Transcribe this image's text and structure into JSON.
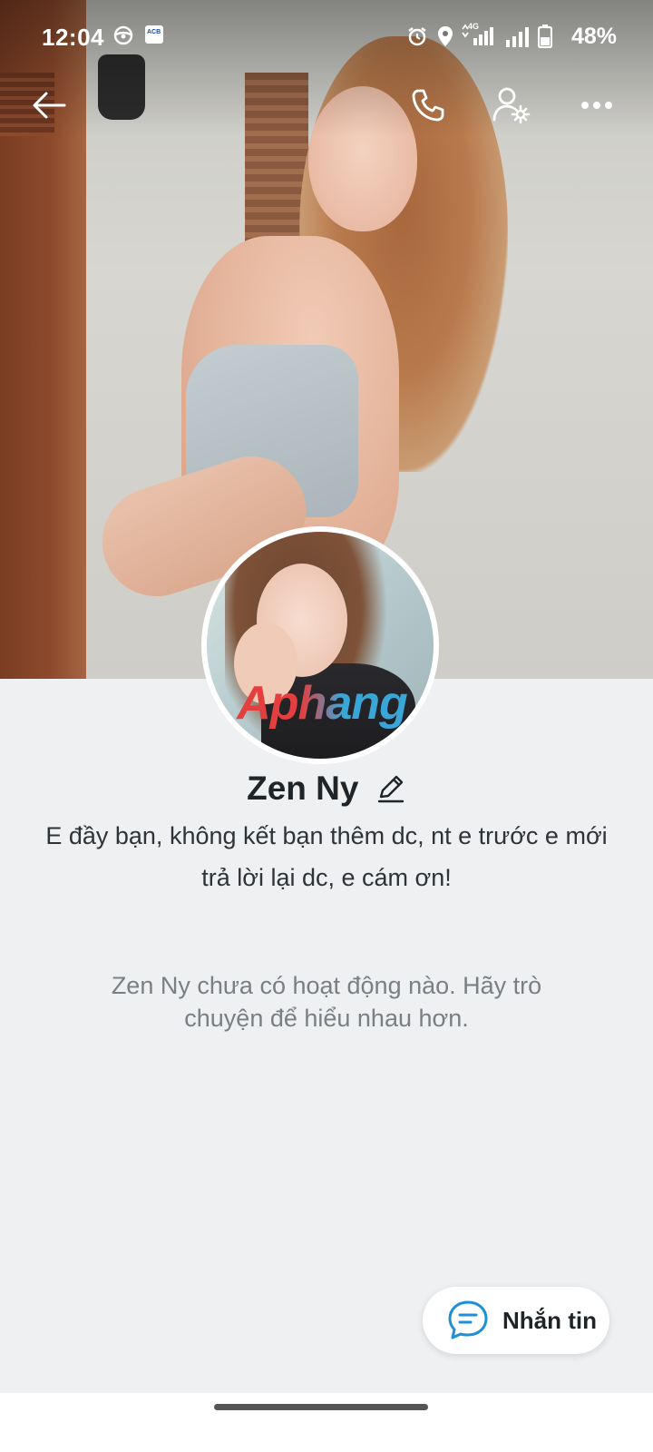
{
  "status_bar": {
    "time": "12:04",
    "battery_text": "48%",
    "network_label": "4G",
    "app_icon_label": "ACB"
  },
  "profile": {
    "name": "Zen Ny",
    "bio": "E đầy bạn, không kết bạn thêm dc, nt e trước e mới trả lời lại dc, e cám ơn!",
    "empty_activity": "Zen Ny chưa có hoạt động nào. Hãy trò chuyện để hiểu nhau hơn.",
    "avatar_watermark": "Aphang"
  },
  "actions": {
    "message_label": "Nhắn tin"
  },
  "icons": {
    "back": "arrow-left-icon",
    "call": "phone-icon",
    "user_settings": "user-gear-icon",
    "more": "more-horizontal-icon",
    "edit": "pencil-icon",
    "message": "chat-bubble-icon"
  },
  "colors": {
    "background": "#eef0f2",
    "accent": "#1f8fd6",
    "text_primary": "#1f2429",
    "text_secondary": "#7a7f85"
  }
}
